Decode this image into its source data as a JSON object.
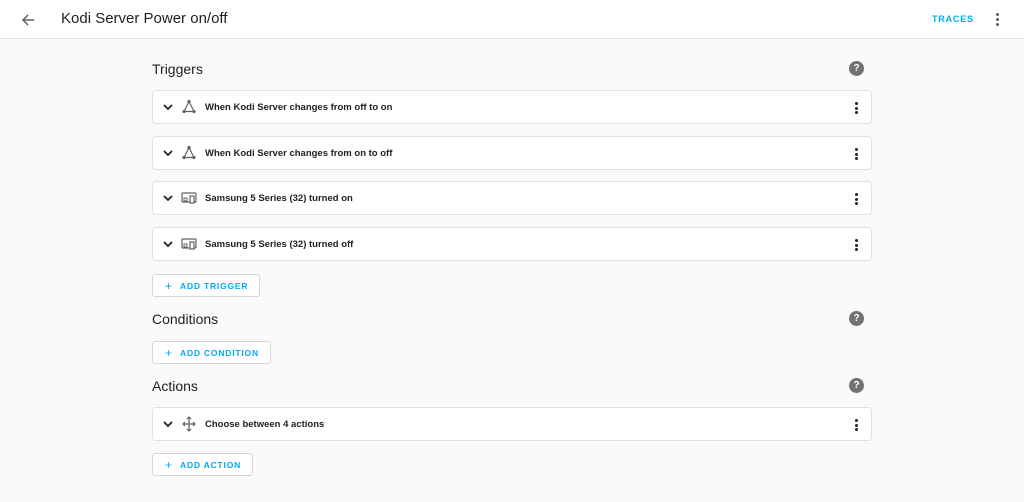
{
  "header": {
    "title": "Kodi Server Power on/off",
    "traces_label": "TRACES"
  },
  "triggers": {
    "title": "Triggers",
    "items": [
      {
        "label": "When Kodi Server changes from off to on",
        "icon": "state-icon"
      },
      {
        "label": "When Kodi Server changes from on to off",
        "icon": "state-icon"
      },
      {
        "label": "Samsung 5 Series (32) turned on",
        "icon": "device-icon"
      },
      {
        "label": "Samsung 5 Series (32) turned off",
        "icon": "device-icon"
      }
    ],
    "add_label": "ADD TRIGGER"
  },
  "conditions": {
    "title": "Conditions",
    "add_label": "ADD CONDITION"
  },
  "actions": {
    "title": "Actions",
    "items": [
      {
        "label": "Choose between 4 actions",
        "icon": "choose-icon"
      }
    ],
    "add_label": "ADD ACTION"
  },
  "colors": {
    "accent": "#03a9f4",
    "help_icon": "#727272",
    "background": "#fafafa"
  }
}
